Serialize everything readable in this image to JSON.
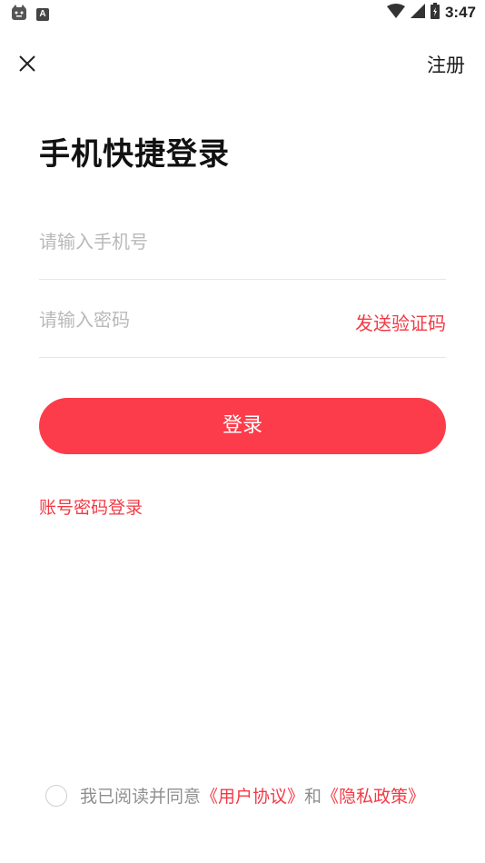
{
  "status_bar": {
    "time": "3:47",
    "notification_letter": "A",
    "icons": [
      "cat-notification-icon",
      "a-notification-icon",
      "wifi-icon",
      "cell-signal-icon",
      "battery-icon"
    ]
  },
  "top_bar": {
    "close_icon": "close-icon",
    "register_label": "注册"
  },
  "title": "手机快捷登录",
  "form": {
    "phone_placeholder": "请输入手机号",
    "phone_value": "",
    "code_placeholder": "请输入密码",
    "code_value": "",
    "send_code_label": "发送验证码"
  },
  "login_button_label": "登录",
  "alt_login_label": "账号密码登录",
  "agreement": {
    "checked": false,
    "prefix": "我已阅读并同意",
    "user_agreement": "《用户协议》",
    "conjunction": "和",
    "privacy_policy": "《隐私政策》"
  },
  "colors": {
    "accent": "#fc3c4a",
    "link": "#f23a45",
    "placeholder": "#b9b9b9",
    "muted_text": "#8f8f8f"
  }
}
